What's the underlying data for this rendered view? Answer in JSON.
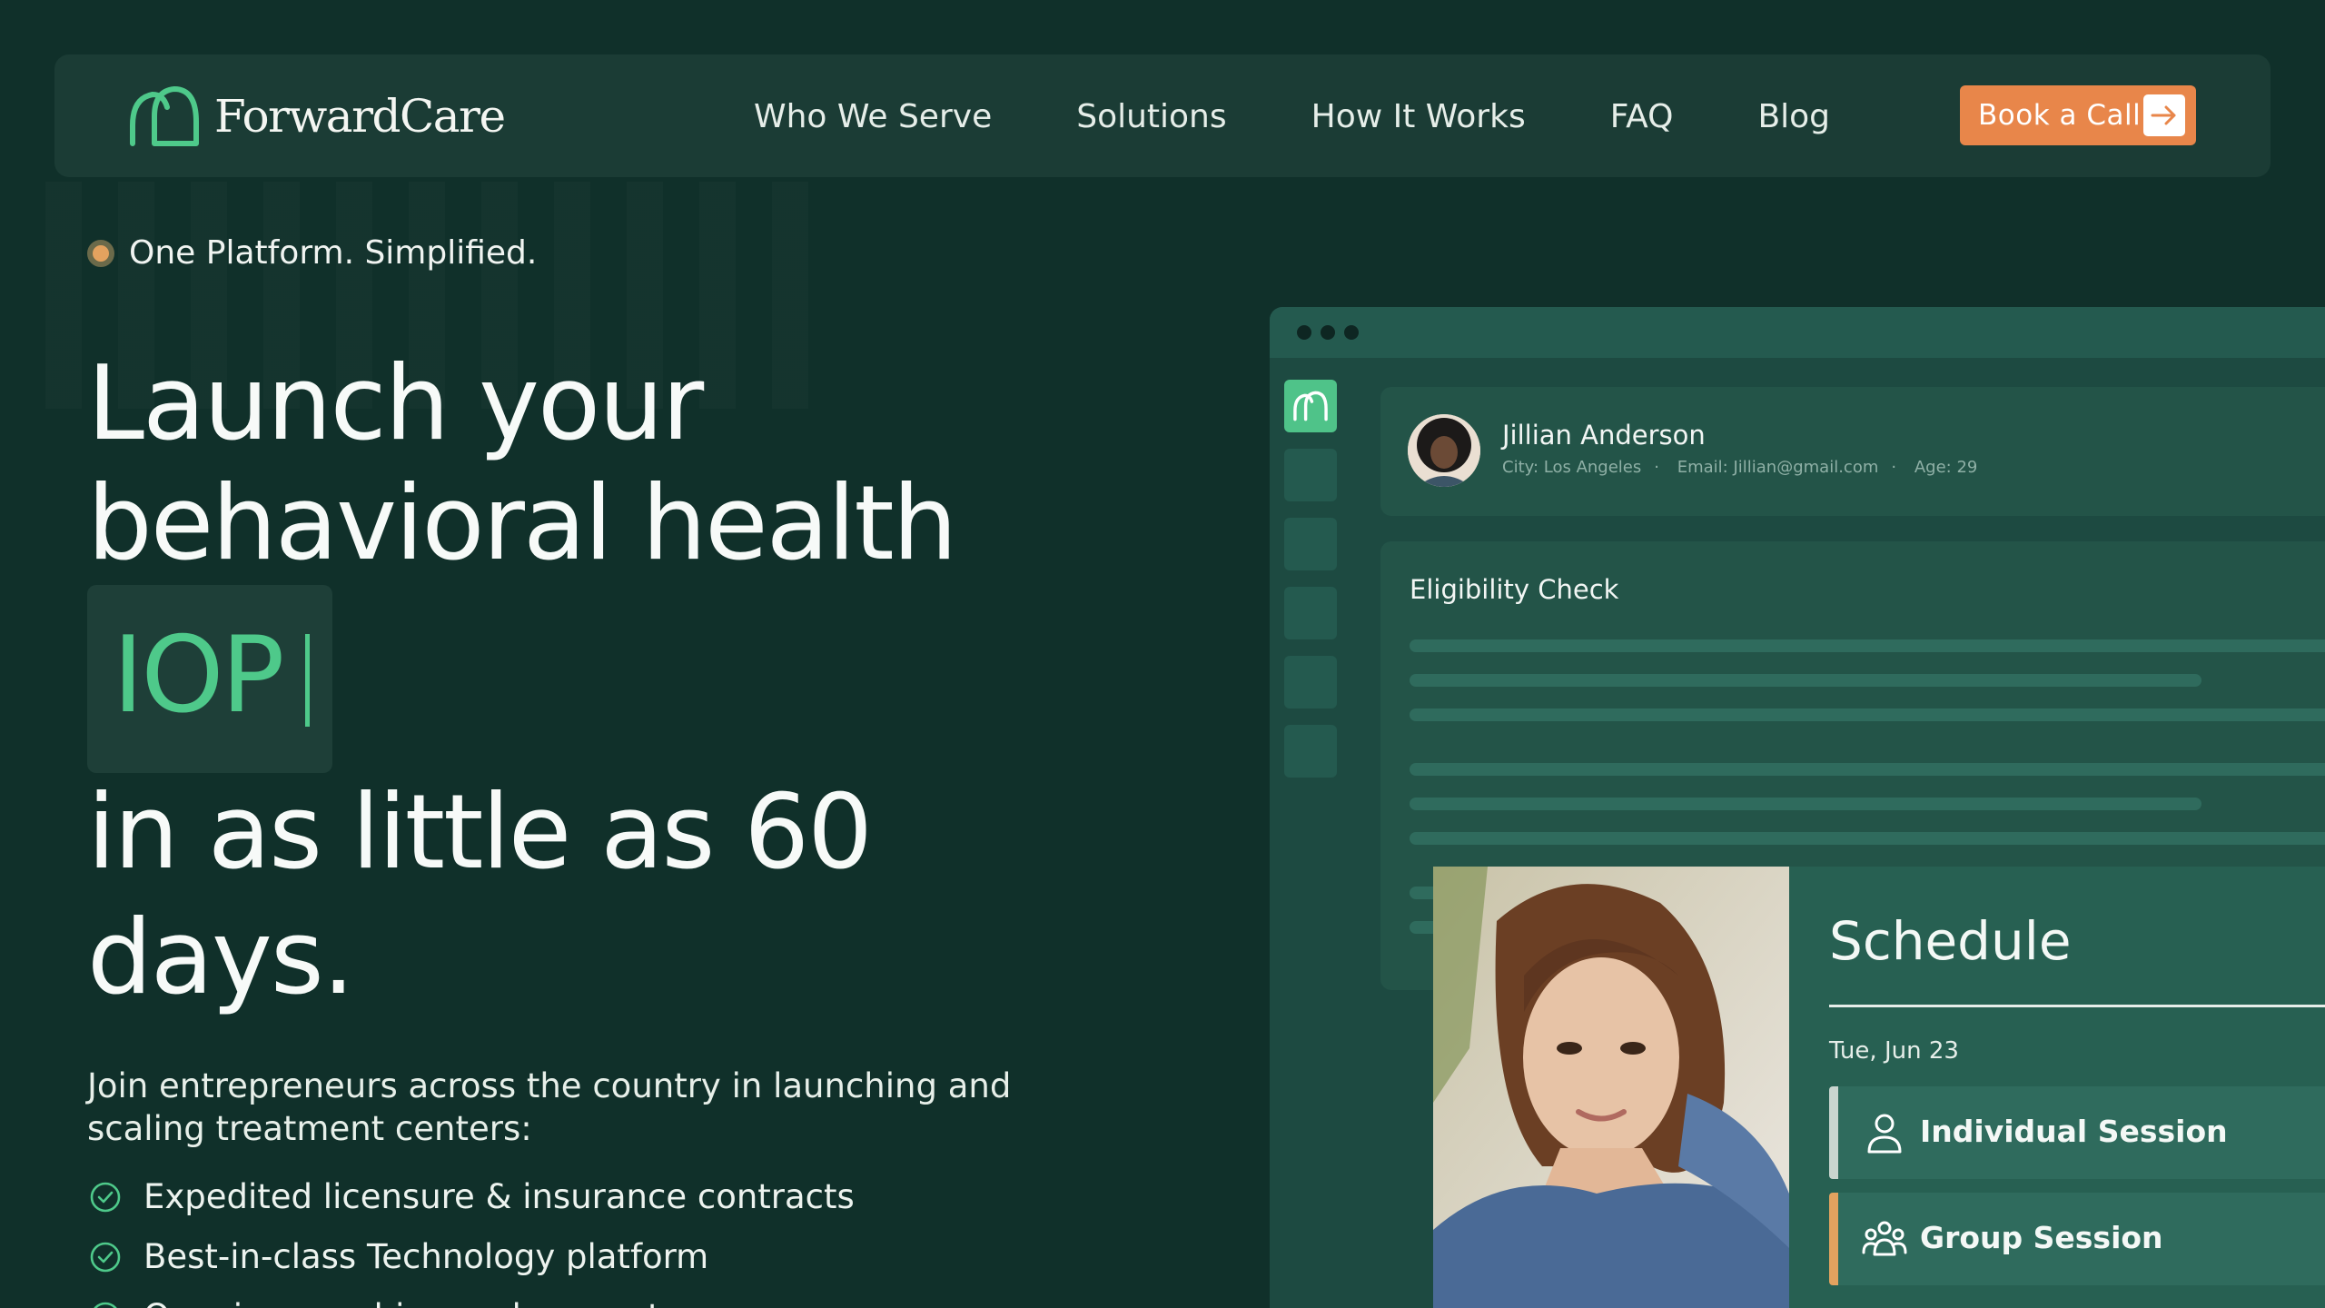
{
  "colors": {
    "background": "#10302a",
    "nav": "#1b3c35",
    "accent_green": "#4ec98a",
    "cta_orange": "#e8864a",
    "app_panel": "#1d4a41"
  },
  "nav": {
    "brand": "ForwardCare",
    "logo_icon": "arch-logo-icon",
    "links": [
      "Who We Serve",
      "Solutions",
      "How It Works",
      "FAQ",
      "Blog"
    ],
    "cta_label": "Book a Call",
    "cta_icon": "arrow-right-icon"
  },
  "hero": {
    "badge": "One Platform. Simplified.",
    "headline_line1": "Launch your",
    "headline_line2": "behavioral health",
    "highlight_word": "IOP",
    "headline_line3": "in as little as 60",
    "headline_line4": "days.",
    "subtitle": "Join entrepreneurs across the country in launching and scaling treatment centers:",
    "bullets": [
      "Expedited licensure & insurance contracts",
      "Best-in-class Technology platform",
      "Ongoing coaching and support"
    ],
    "bullet_icon": "check-circle-icon"
  },
  "app_preview": {
    "patient": {
      "name": "Jillian Anderson",
      "city": "City: Los Angeles",
      "email": "Email: Jillian@gmail.com",
      "age": "Age: 29"
    },
    "eligibility_title": "Eligibility Check",
    "schedule": {
      "title": "Schedule",
      "date": "Tue, Jun 23",
      "sessions": [
        {
          "label": "Individual Session",
          "icon": "person-icon",
          "accent": "#c9d5cf"
        },
        {
          "label": "Group Session",
          "icon": "group-icon",
          "accent": "#e3a25f"
        }
      ]
    }
  }
}
